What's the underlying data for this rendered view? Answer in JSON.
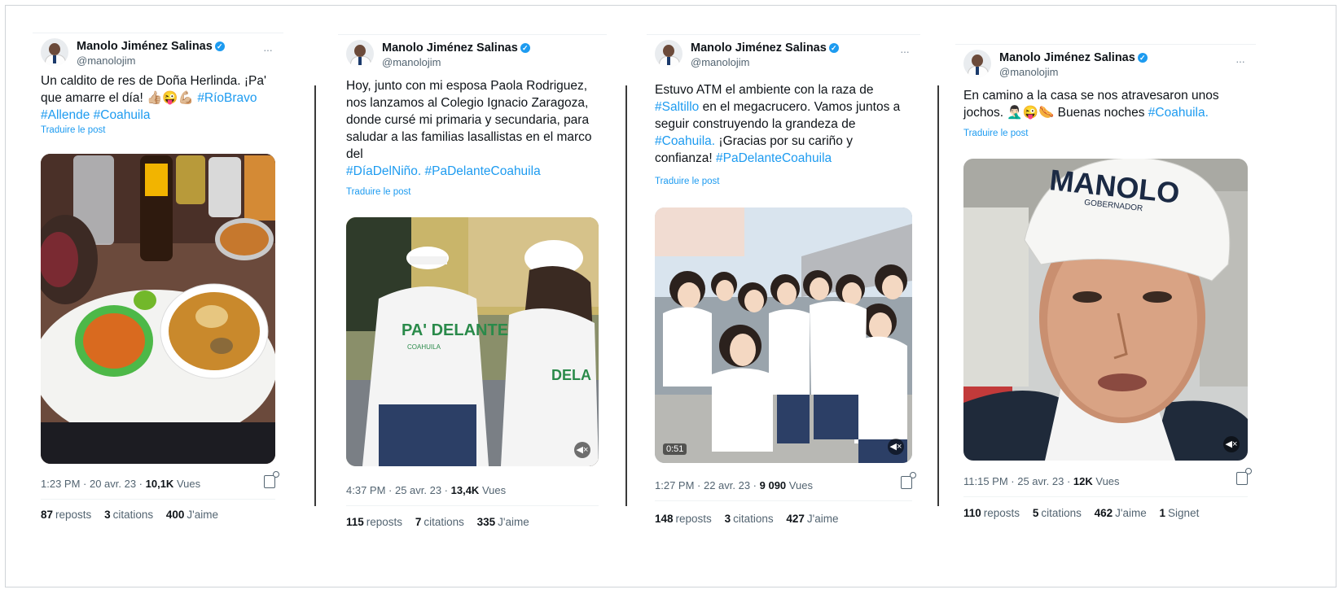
{
  "author": {
    "name": "Manolo Jiménez Salinas",
    "handle": "@manolojim"
  },
  "translate_label": "Traduire le post",
  "labels": {
    "reposts": "reposts",
    "quotes": "citations",
    "likes": "J'aime",
    "bookmarks": "Signet"
  },
  "tweets": [
    {
      "text": "Un caldito de res de Doña Herlinda. ¡Pa' que amarre el día! 👍🏼😜💪🏼",
      "hashtags": [
        "#RíoBravo",
        "#Allende",
        "#Coahuila"
      ],
      "time": "1:23 PM · 20 avr. 23 · ",
      "views": "10,1K",
      "views_label": "Vues",
      "reposts": "87",
      "quotes": "3",
      "likes": "400"
    },
    {
      "text": "Hoy, junto con mi esposa Paola Rodriguez, nos lanzamos al Colegio Ignacio Zaragoza, donde cursé mi primaria y secundaria, para saludar a las familias lasallistas en el marco del",
      "hashtags": [
        "#DíaDelNiño.",
        "#PaDelanteCoahuila"
      ],
      "time": "4:37 PM · 25 avr. 23 · ",
      "views": "13,4K",
      "views_label": "Vues",
      "reposts": "115",
      "quotes": "7",
      "likes": "335",
      "media_text": {
        "back": "PA' DELANTE",
        "sub": "COAHUILA",
        "side": "DELA"
      }
    },
    {
      "text_a": "Estuvo ATM el ambiente con la raza de",
      "tag_a": "#Saltillo",
      "text_b": "en el megacrucero. Vamos juntos a seguir construyendo la grandeza de",
      "tag_b": "#Coahuila.",
      "text_c": "¡Gracias por su cariño y confianza!",
      "tag_c": "#PaDelanteCoahuila",
      "time": "1:27 PM · 22 avr. 23 · ",
      "views": "9 090",
      "views_label": "Vues",
      "reposts": "148",
      "quotes": "3",
      "likes": "427",
      "duration": "0:51"
    },
    {
      "text": "En camino a la casa se nos atravesaron unos jochos. 🤦🏻‍♂️😜🌭 Buenas noches",
      "tag": "#Coahuila.",
      "time": "11:15 PM · 25 avr. 23 · ",
      "views": "12K",
      "views_label": "Vues",
      "reposts": "110",
      "quotes": "5",
      "likes": "462",
      "bookmarks": "1",
      "cap_text": {
        "main": "MANOLO",
        "sub": "GOBERNADOR"
      }
    }
  ],
  "colors": {
    "link": "#1d9bf0",
    "verified": "#1d9bf0",
    "muted": "#536471"
  }
}
